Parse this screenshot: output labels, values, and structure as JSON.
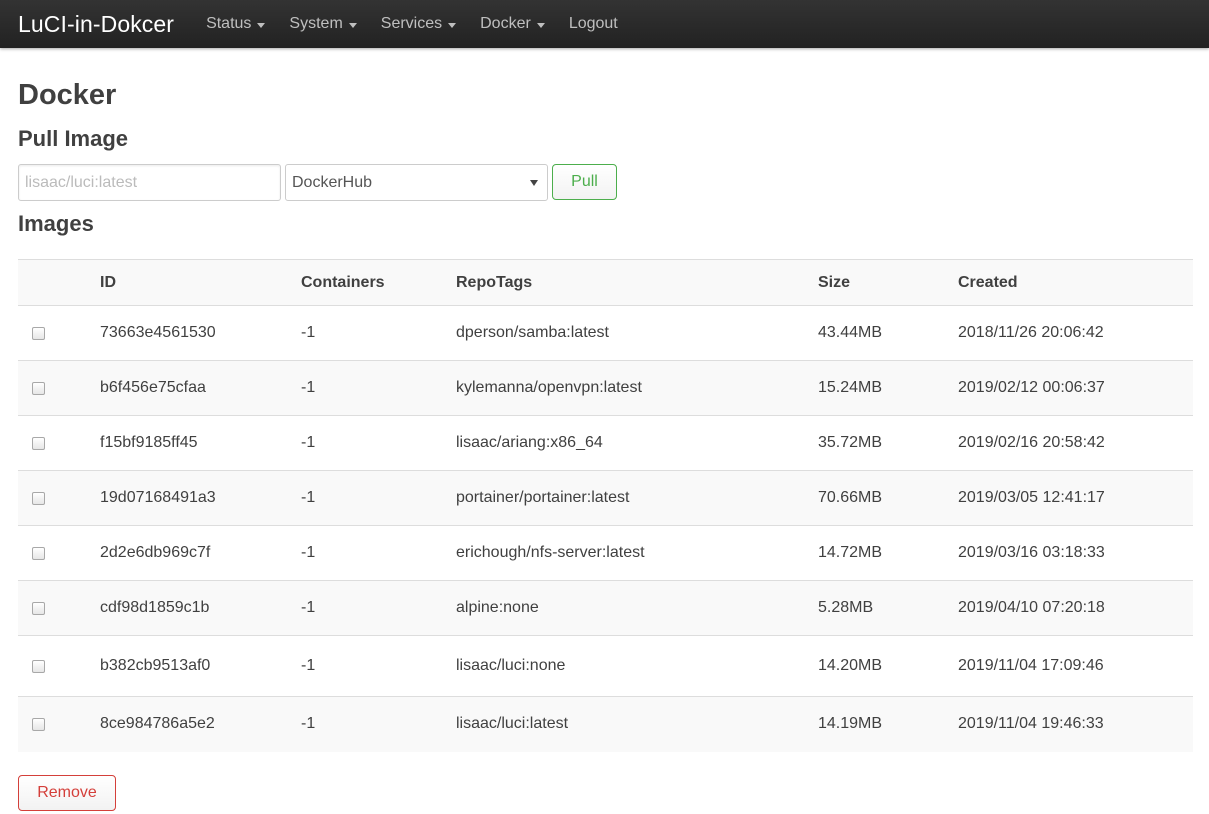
{
  "navbar": {
    "brand": "LuCI-in-Dokcer",
    "items": [
      {
        "label": "Status",
        "dropdown": true
      },
      {
        "label": "System",
        "dropdown": true
      },
      {
        "label": "Services",
        "dropdown": true
      },
      {
        "label": "Docker",
        "dropdown": true
      },
      {
        "label": "Logout",
        "dropdown": false
      }
    ]
  },
  "page": {
    "title": "Docker",
    "pull_section_title": "Pull Image",
    "images_section_title": "Images"
  },
  "pull": {
    "image_placeholder": "lisaac/luci:latest",
    "registry_selected": "DockerHub",
    "pull_label": "Pull"
  },
  "table": {
    "columns": [
      "",
      "ID",
      "Containers",
      "RepoTags",
      "Size",
      "Created"
    ],
    "rows": [
      {
        "id": "73663e4561530",
        "containers": "-1",
        "repotags": "dperson/samba:latest",
        "size": "43.44MB",
        "created": "2018/11/26 20:06:42",
        "checked": false
      },
      {
        "id": "b6f456e75cfaa",
        "containers": "-1",
        "repotags": "kylemanna/openvpn:latest",
        "size": "15.24MB",
        "created": "2019/02/12 00:06:37",
        "checked": false
      },
      {
        "id": "f15bf9185ff45",
        "containers": "-1",
        "repotags": "lisaac/ariang:x86_64",
        "size": "35.72MB",
        "created": "2019/02/16 20:58:42",
        "checked": false
      },
      {
        "id": "19d07168491a3",
        "containers": "-1",
        "repotags": "portainer/portainer:latest",
        "size": "70.66MB",
        "created": "2019/03/05 12:41:17",
        "checked": false
      },
      {
        "id": "2d2e6db969c7f",
        "containers": "-1",
        "repotags": "erichough/nfs-server:latest",
        "size": "14.72MB",
        "created": "2019/03/16 03:18:33",
        "checked": false
      },
      {
        "id": "cdf98d1859c1b",
        "containers": "-1",
        "repotags": "alpine:none",
        "size": "5.28MB",
        "created": "2019/04/10 07:20:18",
        "checked": false
      },
      {
        "id": "b382cb9513af0",
        "containers": "-1",
        "repotags": "lisaac/luci:none",
        "size": "14.20MB",
        "created": "2019/11/04 17:09:46",
        "checked": false
      },
      {
        "id": "8ce984786a5e2",
        "containers": "-1",
        "repotags": "lisaac/luci:latest",
        "size": "14.19MB",
        "created": "2019/11/04 19:46:33",
        "checked": false
      }
    ]
  },
  "actions": {
    "remove_label": "Remove"
  },
  "colors": {
    "navbar_bg": "#222222",
    "pull_button": "#4cae4c",
    "remove_button": "#d43f3a"
  }
}
